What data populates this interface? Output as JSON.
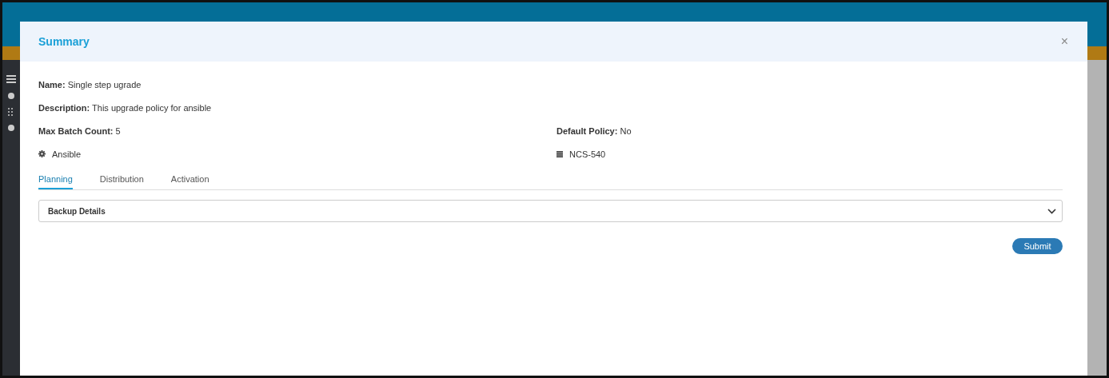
{
  "dialog": {
    "title": "Summary",
    "close": "×"
  },
  "details": [
    [
      {
        "label": "Name:",
        "value": "Single step ugrade"
      }
    ],
    [
      {
        "label": "Description:",
        "value": "This upgrade policy for ansible"
      }
    ],
    [
      {
        "label": "Max Batch Count:",
        "value": "5"
      },
      {
        "label": "Default Policy:",
        "value": "No"
      }
    ]
  ],
  "automation_tool": "Ansible",
  "device_family": "NCS-540",
  "tabs": [
    {
      "label": "Planning",
      "selected": true
    },
    {
      "label": "Distribution",
      "selected": false
    },
    {
      "label": "Activation",
      "selected": false
    }
  ],
  "accordion": {
    "title": "Backup Details",
    "expanded": false
  },
  "buttons": [
    "Submit"
  ]
}
